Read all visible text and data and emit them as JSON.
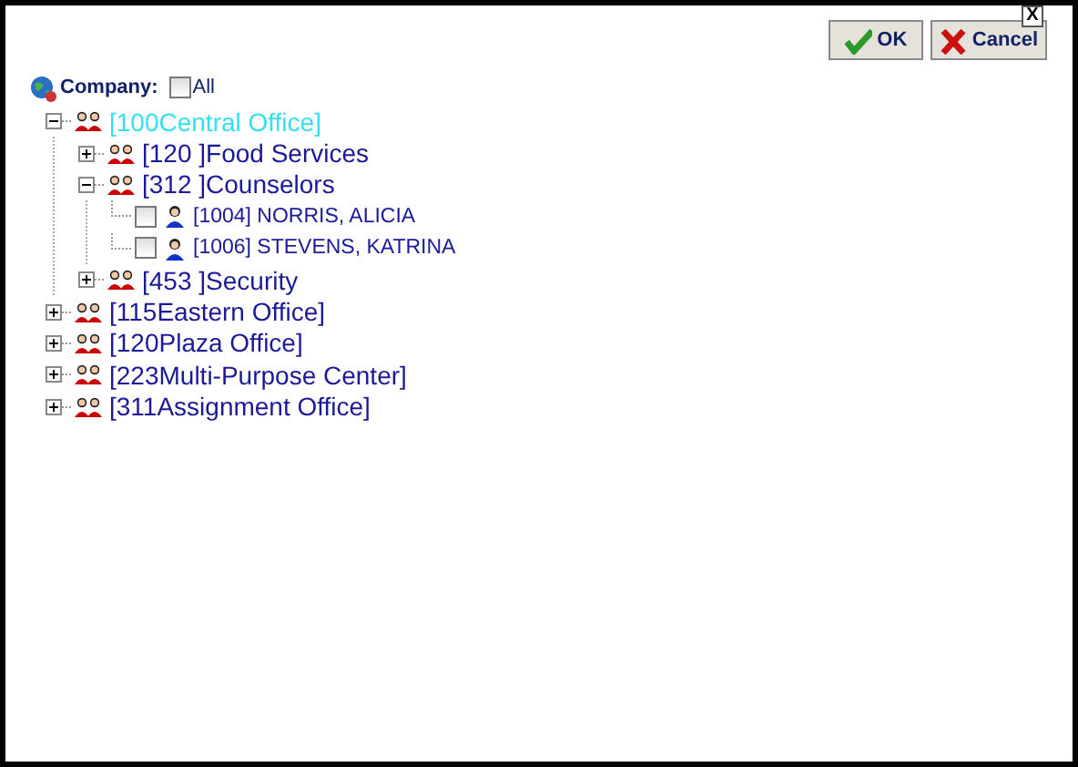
{
  "buttons": [
    {
      "label": "OK",
      "kind": "ok"
    },
    {
      "label": "Cancel",
      "kind": "cancel"
    }
  ],
  "close": {
    "label": "X"
  },
  "company": {
    "label": "Company:",
    "all": {
      "label": "All",
      "checked": false
    }
  },
  "tree": [
    {
      "kind": "group",
      "label": "[100Central Office]",
      "selected": true,
      "expanded": true,
      "children": [
        {
          "kind": "group",
          "label": "[120 ]Food Services",
          "selected": false,
          "expanded": false
        },
        {
          "kind": "group",
          "label": "[312 ]Counselors",
          "selected": false,
          "expanded": true,
          "children": [
            {
              "kind": "employee",
              "label": "[1004] NORRIS, ALICIA",
              "selected": false,
              "checked": false
            },
            {
              "kind": "employee",
              "label": "[1006] STEVENS, KATRINA",
              "selected": false,
              "checked": false
            }
          ]
        },
        {
          "kind": "group",
          "label": "[453 ]Security",
          "selected": false,
          "expanded": false
        }
      ]
    },
    {
      "kind": "group",
      "label": "[115Eastern Office]",
      "selected": false,
      "expanded": false
    },
    {
      "kind": "group",
      "label": "[120Plaza Office]",
      "selected": false,
      "expanded": false
    },
    {
      "kind": "group",
      "label": "[223Multi-Purpose Center]",
      "selected": false,
      "expanded": false
    },
    {
      "kind": "group",
      "label": "[311Assignment Office]",
      "selected": false,
      "expanded": false
    }
  ]
}
